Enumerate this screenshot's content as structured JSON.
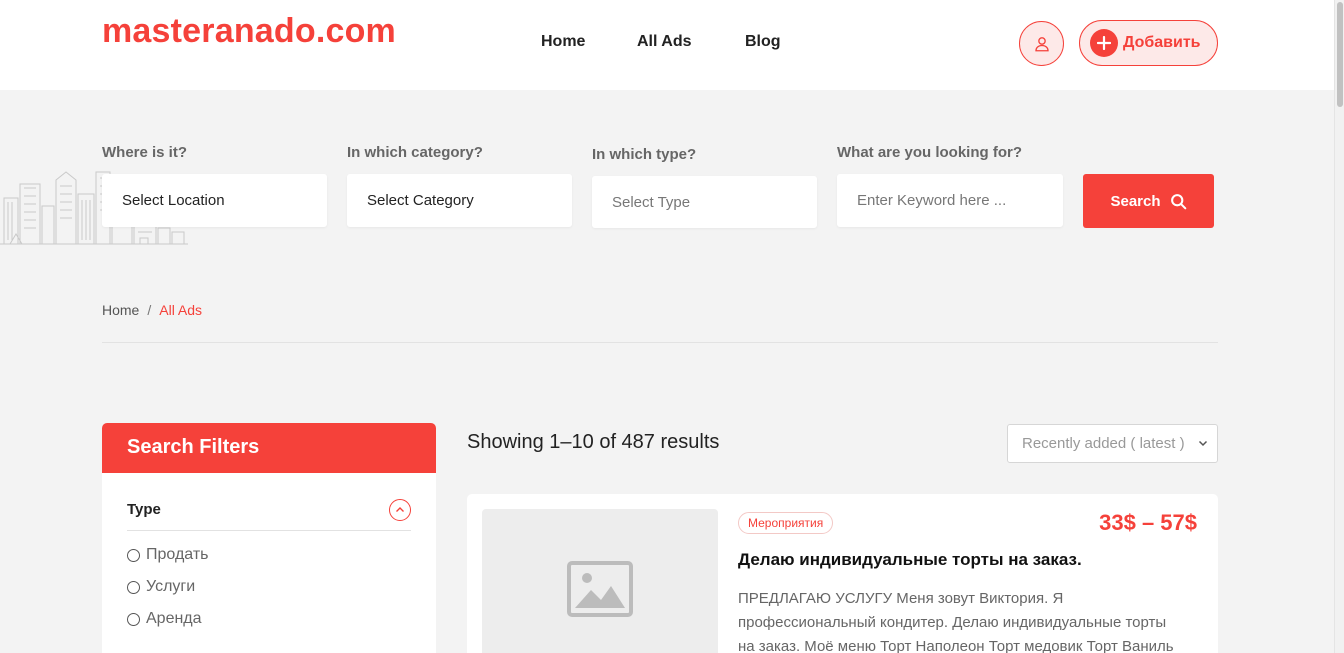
{
  "header": {
    "logo": "masteranado.com",
    "nav": [
      "Home",
      "All Ads",
      "Blog"
    ],
    "user_icon": "user-icon",
    "add_label": "Добавить",
    "add_icon": "plus-circle-icon"
  },
  "search": {
    "location": {
      "label": "Where is it?",
      "value": "Select Location"
    },
    "category": {
      "label": "In which category?",
      "value": "Select Category"
    },
    "type": {
      "label": "In which type?",
      "value": "Select Type"
    },
    "keyword": {
      "label": "What are you looking for?",
      "placeholder": "Enter Keyword here ..."
    },
    "button": "Search",
    "button_icon": "search-icon"
  },
  "breadcrumb": {
    "home": "Home",
    "separator": "/",
    "current": "All Ads"
  },
  "filters": {
    "title": "Search Filters",
    "type_label": "Type",
    "options": [
      "Продать",
      "Услуги",
      "Аренда"
    ]
  },
  "results": {
    "showing": "Showing 1–10 of 487 results",
    "sort": "Recently added ( latest )"
  },
  "listing": {
    "badge": "Мероприятия",
    "price": "33$ – 57$",
    "title": "Делаю индивидуальные торты на заказ.",
    "desc_lines": [
      "ПРЕДЛАГАЮ УСЛУГУ Меня зовут Виктория. Я",
      "профессиональный кондитер. Делаю индивидуальные торты",
      "на заказ. Моё меню Торт Наполеон Торт медовик Торт Ваниль"
    ],
    "image_icon": "image-placeholder-icon"
  },
  "colors": {
    "accent": "#f5413a",
    "accent_light": "#fde9e8",
    "background": "#f3f3f3"
  }
}
